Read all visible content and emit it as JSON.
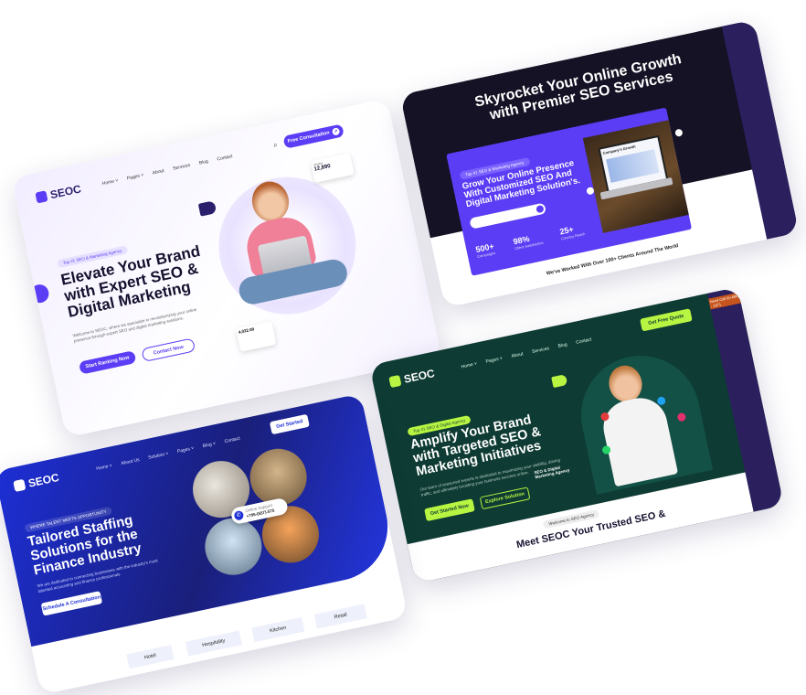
{
  "card1": {
    "logo": "SEOC",
    "nav": [
      "Home ˅",
      "Pages ˅",
      "About",
      "Services",
      "Blog",
      "Contact"
    ],
    "cta": "Free Consultation",
    "tag": "Top #1 SEO & Marketing Agency",
    "headline": [
      "Elevate Your Brand",
      "with Expert SEO &",
      "Digital Marketing"
    ],
    "para": "Welcome to SEOC, where we specialize in revolutionizing your online presence through expert SEO and digital marketing solutions.",
    "btn_primary": "Start Ranking Now",
    "btn_secondary": "Contact Now",
    "stat_label": "Visitor",
    "stat_value": "12,890",
    "mini_value": "4,022.09"
  },
  "card2": {
    "headline": [
      "Skyrocket Your Online Growth",
      "with Premier SEO Services"
    ],
    "tag": "Top #1 SEO & Marketing Agency",
    "box_title": [
      "Grow Your Online Presence",
      "With Customized SEO And",
      "Digital Marketing Solution's."
    ],
    "stats": [
      {
        "value": "500+",
        "label": "Campaigns"
      },
      {
        "value": "98%",
        "label": "Client Satisfaction"
      },
      {
        "value": "25+",
        "label": "Country Reach"
      }
    ],
    "screen_title": "Company's Growth",
    "clients": "We've Worked With Over 100+ Clients Around The World"
  },
  "card3": {
    "logo": "SEOC",
    "nav": [
      "Home ˅",
      "Pages ˅",
      "About",
      "Services",
      "Blog",
      "Contact"
    ],
    "cta": "Get Free Quote",
    "side_text": "Need Call 0(+880) - 1471",
    "tag": "Top #1 SEO & Digital Agency",
    "headline": [
      "Amplify Your Brand",
      "with Targeted SEO &",
      "Marketing Initiatives"
    ],
    "para": "Our team of seasoned experts is dedicated to maximizing your visibility, driving traffic, and ultimately boosting your business success online.",
    "btn_primary": "Get Started Now",
    "btn_secondary": "Explore Solution",
    "badge": "SEO & Digital Marketing Agency",
    "welcome": "Welcome to SEO Agency",
    "meet": [
      "Meet SEOC Your Trusted SEO &"
    ]
  },
  "card4": {
    "logo": "SEOC",
    "nav": [
      "Home ˅",
      "About Us",
      "Solution ˅",
      "Pages ˅",
      "Blog ˅",
      "Contact"
    ],
    "cta": "Get Started",
    "tag": "WHERE TALENT MEETS OPPORTUNITY",
    "headline": [
      "Tailored Staffing",
      "Solutions for the",
      "Finance Industry"
    ],
    "para": "We are dedicated to connecting businesses with the industry's most talented accounting and finance professionals.",
    "btn": "Schedule A Consultation",
    "phone_label": "Online Support",
    "phone": "+795-(557)-575",
    "categories": [
      "Hotel",
      "Hospitality",
      "Kitchen",
      "Retail"
    ]
  },
  "colors": {
    "purple": "#5b3df5",
    "dark": "#141224",
    "green_bg": "#0e3b33",
    "lime": "#b8f542",
    "blue": "#1d2fd6"
  }
}
